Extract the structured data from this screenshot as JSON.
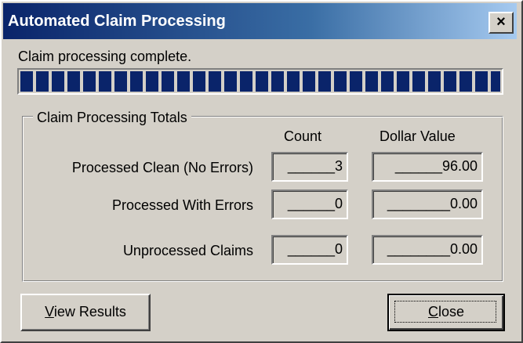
{
  "window": {
    "title": "Automated Claim Processing",
    "close_glyph": "×"
  },
  "status": {
    "message": "Claim processing complete.",
    "progress_percent": 100
  },
  "totals": {
    "group_label": "Claim Processing Totals",
    "columns": {
      "count": "Count",
      "dollar_value": "Dollar Value"
    },
    "rows": [
      {
        "label": "Processed Clean (No Errors)",
        "count": "______3",
        "dollar_value": "______96.00"
      },
      {
        "label": "Processed With Errors",
        "count": "______0",
        "dollar_value": "________0.00"
      },
      {
        "label": "Unprocessed Claims",
        "count": "______0",
        "dollar_value": "________0.00"
      }
    ]
  },
  "buttons": {
    "view_results": {
      "accel": "V",
      "rest": "iew Results"
    },
    "close": {
      "accel": "C",
      "rest": "lose"
    }
  },
  "colors": {
    "title_bar": "#0a246a",
    "face": "#d4d0c8",
    "progress": "#0a246a"
  }
}
